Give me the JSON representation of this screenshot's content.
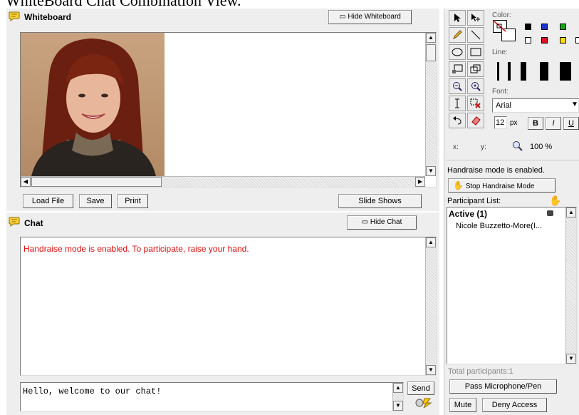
{
  "page_caption": "WhiteBoard Chat Combination View.",
  "whiteboard": {
    "title": "Whiteboard",
    "hide_label": "Hide Whiteboard",
    "load_label": "Load File",
    "save_label": "Save",
    "print_label": "Print",
    "slideshows_label": "Slide Shows"
  },
  "chat": {
    "title": "Chat",
    "hide_label": "Hide Chat",
    "system_message": "Handraise mode is enabled. To participate, raise your hand.",
    "system_message_color": "#e01010",
    "input_value": "Hello, welcome to our chat!",
    "send_label": "Send"
  },
  "tools": {
    "color_label": "Color:",
    "line_label": "Line:",
    "font_label": "Font:",
    "font_value": "Arial",
    "size_value": "12",
    "size_unit": "px",
    "bold": "B",
    "italic": "I",
    "underline": "U",
    "x_label": "x:",
    "y_label": "y:",
    "zoom": "100 %",
    "colors": [
      "#000000",
      "#1a33cc",
      "#11aa11",
      "#ffffff",
      "#dd1122",
      "#ffdd00"
    ]
  },
  "participants": {
    "handraise_status": "Handraise mode is enabled.",
    "stop_label": "Stop Handraise Mode",
    "list_label": "Participant List:",
    "active_header": "Active (1)",
    "names": [
      "Nicole Buzzetto-More(I..."
    ],
    "total": "Total participants:1",
    "pass_label": "Pass Microphone/Pen",
    "mute_label": "Mute",
    "deny_label": "Deny Access"
  }
}
